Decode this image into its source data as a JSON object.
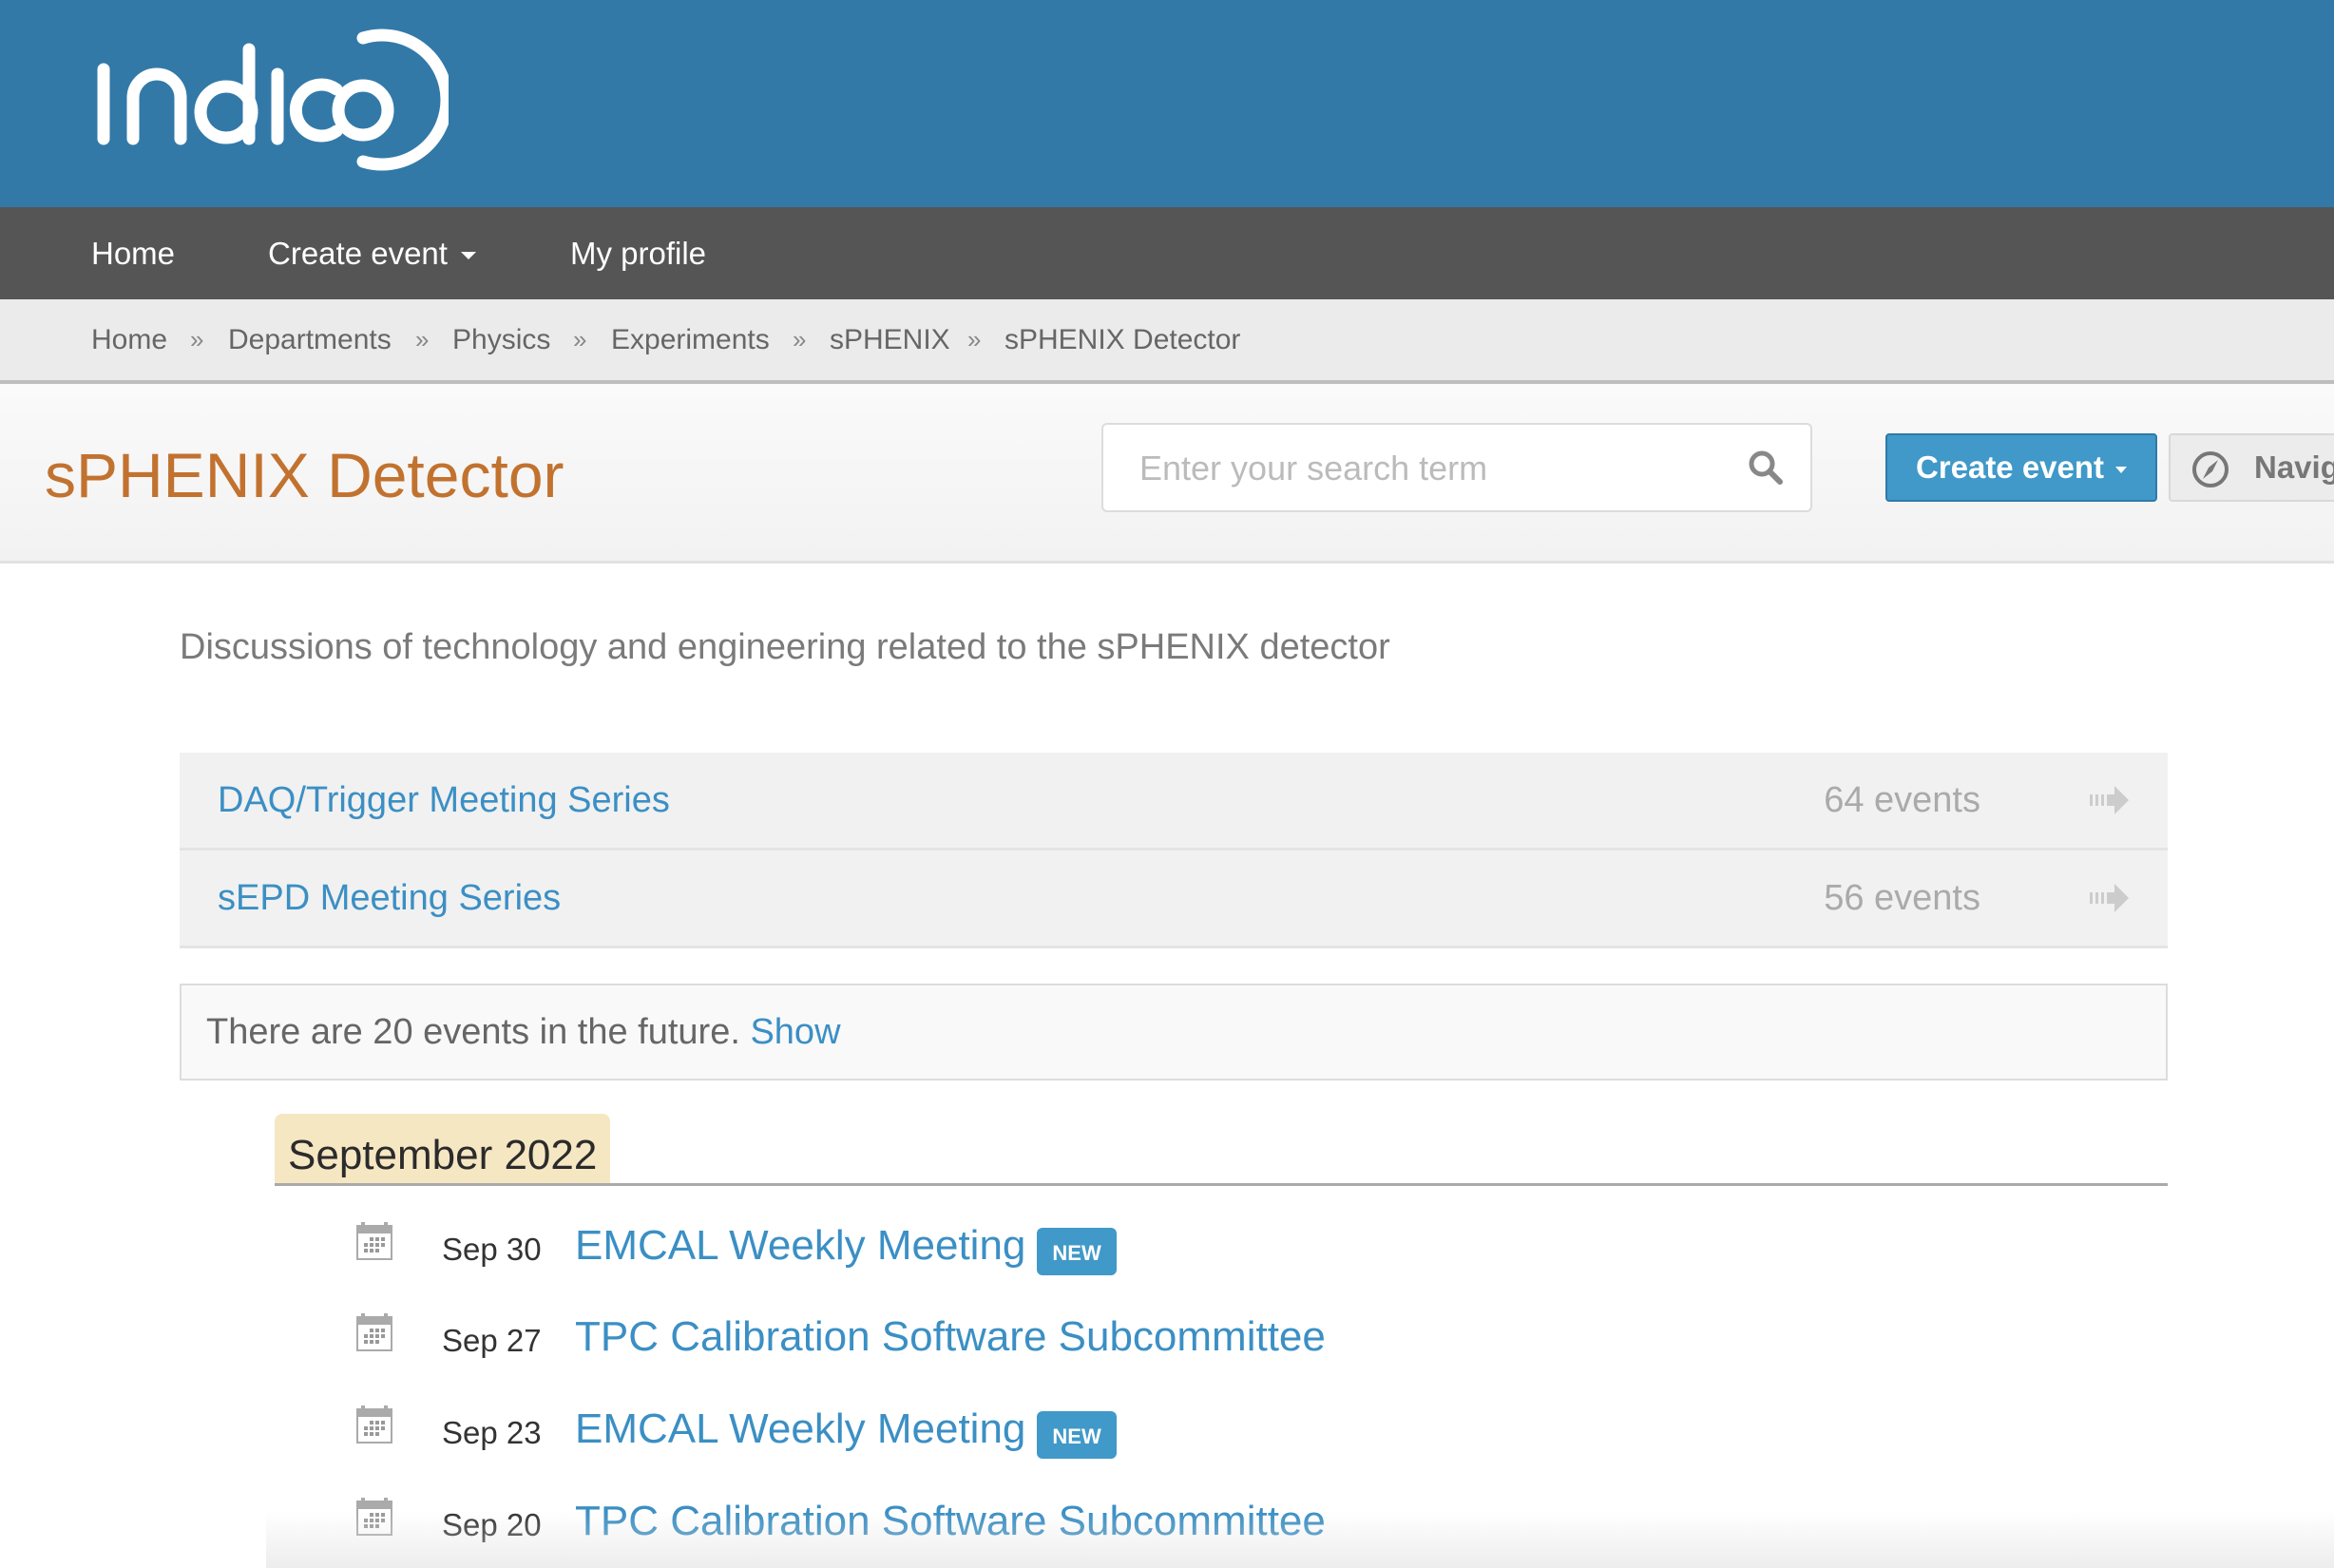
{
  "header": {
    "logo_text": "indico",
    "brand_color": "#3279a8"
  },
  "nav": {
    "items": [
      {
        "label": "Home"
      },
      {
        "label": "Create event",
        "has_dropdown": true
      },
      {
        "label": "My profile"
      }
    ]
  },
  "breadcrumb": {
    "items": [
      "Home",
      "Departments",
      "Physics",
      "Experiments",
      "sPHENIX",
      "sPHENIX Detector"
    ],
    "separator": "»"
  },
  "page": {
    "title": "sPHENIX Detector",
    "title_color": "#c2722f",
    "search_placeholder": "Enter your search term",
    "search_value": "",
    "create_event_label": "Create event",
    "navigate_label": "Navigate",
    "description": "Discussions of technology and engineering related to the sPHENIX detector"
  },
  "series": [
    {
      "name": "DAQ/Trigger Meeting Series",
      "count": "64 events",
      "icon": "arrow-right-icon"
    },
    {
      "name": "sEPD Meeting Series",
      "count": "56 events",
      "icon": "arrow-right-icon"
    }
  ],
  "future": {
    "text": "There are 20 events in the future. ",
    "link": "Show"
  },
  "month": "September 2022",
  "events": [
    {
      "date": "Sep 30",
      "title": "EMCAL Weekly Meeting",
      "badge": "NEW",
      "icon": "calendar-icon"
    },
    {
      "date": "Sep 27",
      "title": "TPC Calibration Software Subcommittee",
      "badge": null,
      "icon": "calendar-icon"
    },
    {
      "date": "Sep 23",
      "title": "EMCAL Weekly Meeting",
      "badge": "NEW",
      "icon": "calendar-icon"
    },
    {
      "date": "Sep 20",
      "title": "TPC Calibration Software Subcommittee",
      "badge": null,
      "icon": "calendar-icon"
    }
  ]
}
